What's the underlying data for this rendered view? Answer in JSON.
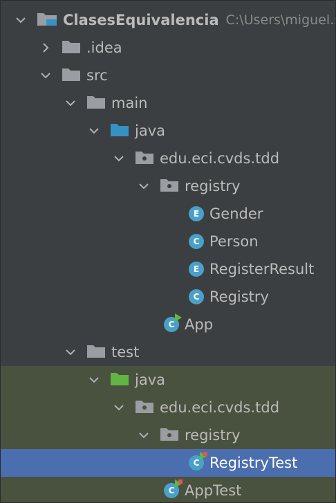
{
  "project": {
    "name": "ClasesEquivalencia",
    "path": "C:\\Users\\miguel.s"
  },
  "tree": {
    "idea": ".idea",
    "src": "src",
    "main": "main",
    "java_main": "java",
    "pkg_main": "edu.eci.cvds.tdd",
    "registry_main": "registry",
    "gender": "Gender",
    "gender_badge": "E",
    "person": "Person",
    "person_badge": "C",
    "register_result": "RegisterResult",
    "register_result_badge": "E",
    "registry": "Registry",
    "registry_badge": "C",
    "app": "App",
    "app_badge": "C",
    "test": "test",
    "java_test": "java",
    "pkg_test": "edu.eci.cvds.tdd",
    "registry_test_pkg": "registry",
    "registry_test": "RegistryTest",
    "registry_test_badge": "C",
    "app_test": "AppTest",
    "app_test_badge": "C"
  },
  "colors": {
    "background": "#3c3f41",
    "test_area": "#49523f",
    "selected": "#4b6eaf",
    "folder_gray": "#9a9ea3",
    "folder_blue": "#3592c4",
    "folder_green": "#62b543",
    "icon_blue": "#4aa1c7",
    "run_green": "#62b543",
    "run_red": "#e05555"
  }
}
